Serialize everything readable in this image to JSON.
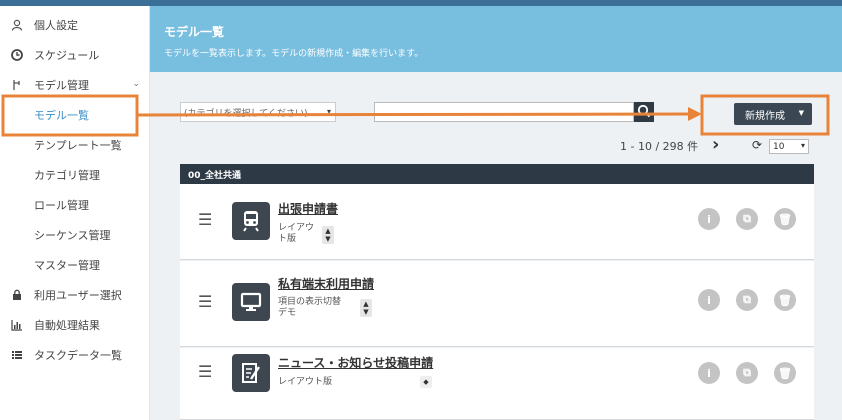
{
  "sidebar": {
    "items": [
      {
        "label": "個人設定",
        "icon": "person-icon"
      },
      {
        "label": "スケジュール",
        "icon": "clock-icon"
      },
      {
        "label": "モデル管理",
        "icon": "branch-icon"
      },
      {
        "label": "モデル一覧"
      },
      {
        "label": "テンプレート一覧"
      },
      {
        "label": "カテゴリ管理"
      },
      {
        "label": "ロール管理"
      },
      {
        "label": "シーケンス管理"
      },
      {
        "label": "マスター管理"
      },
      {
        "label": "利用ユーザー選択",
        "icon": "lock-icon"
      },
      {
        "label": "自動処理結果",
        "icon": "bar-chart-icon"
      },
      {
        "label": "タスクデータ一覧",
        "icon": "list-icon"
      }
    ]
  },
  "header": {
    "title": "モデル一覧",
    "description": "モデルを一覧表示します。モデルの新規作成・編集を行います。"
  },
  "toolbar": {
    "category_select": "(カテゴリを選択してください)",
    "search_value": "",
    "new_button": "新規作成"
  },
  "pagination": {
    "summary": "1 - 10 / 298 件",
    "per_page": "10"
  },
  "group": {
    "name": "00_全社共通"
  },
  "models": [
    {
      "name": "出張申請書",
      "subtitle": "レイアウト版",
      "icon": "train-icon"
    },
    {
      "name": "私有端末利用申請",
      "subtitle": "項目の表示切替デモ",
      "icon": "monitor-icon"
    },
    {
      "name": "ニュース・お知らせ投稿申請",
      "subtitle": "レイアウト版",
      "icon": "edit-note-icon"
    }
  ],
  "colors": {
    "banner": "#78bedf",
    "topbar": "#3c6f98",
    "accent": "#3a8fc9",
    "annotation": "#e8843a"
  }
}
